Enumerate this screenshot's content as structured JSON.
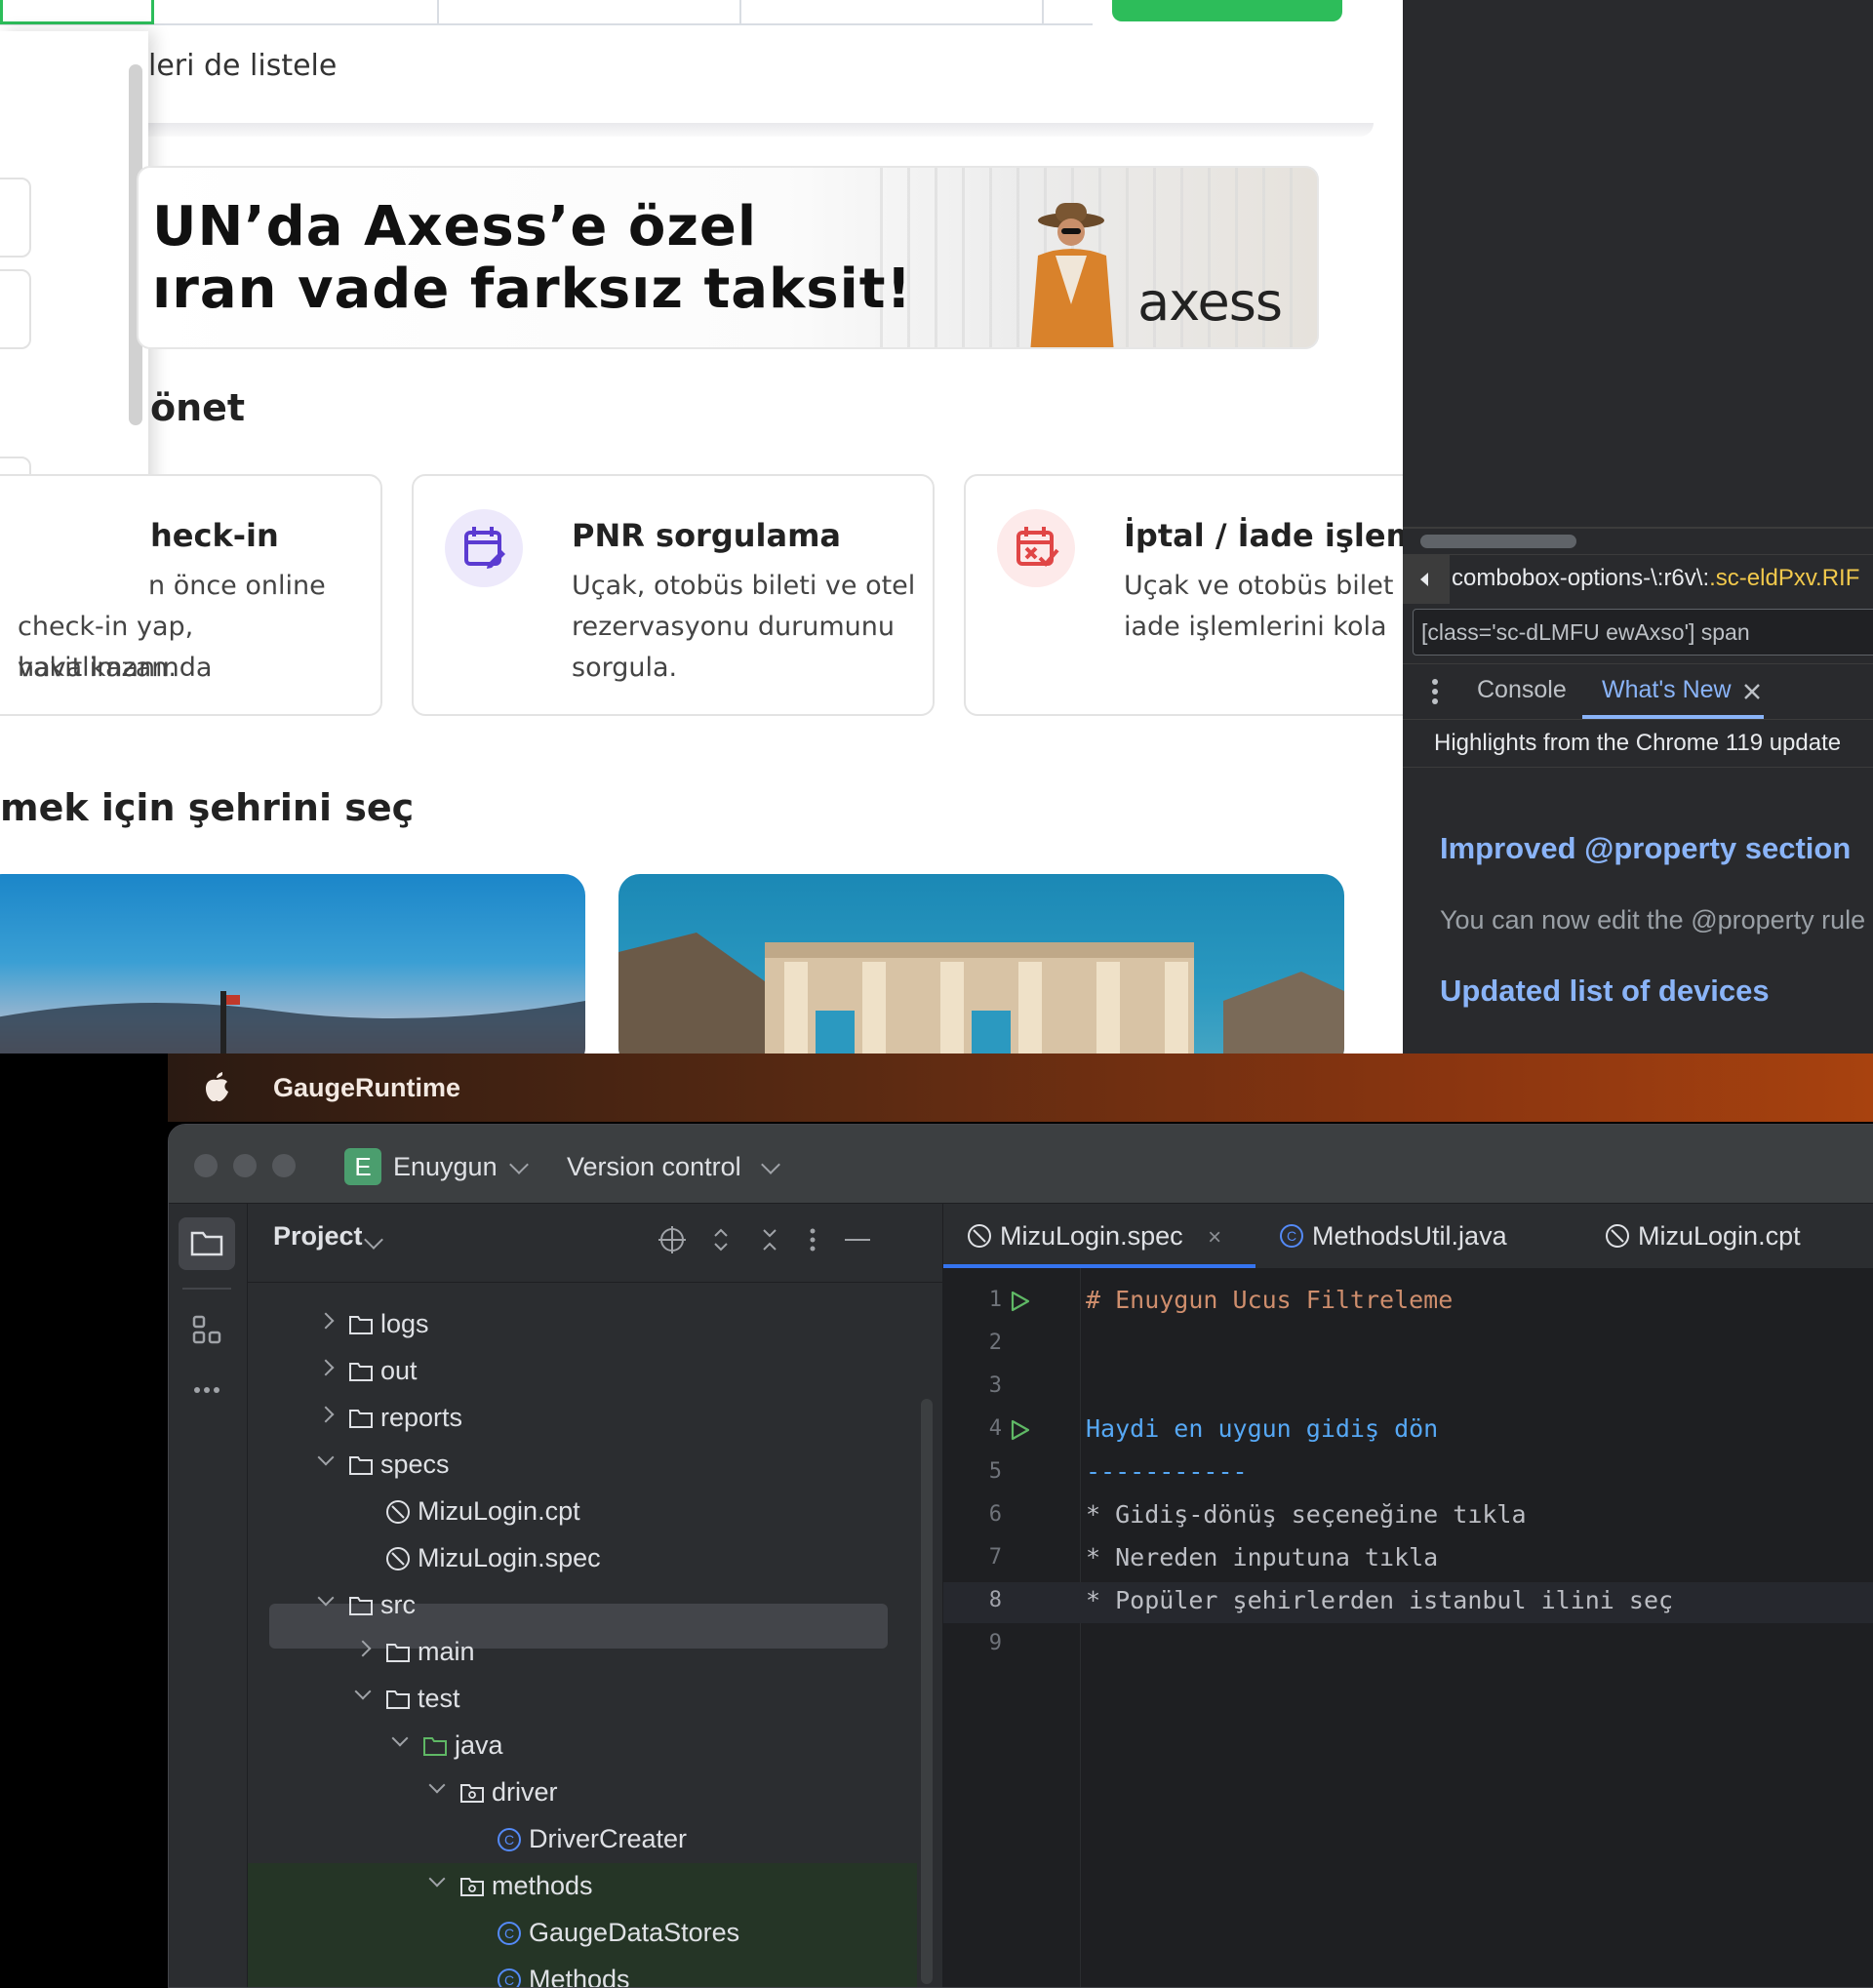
{
  "browser": {
    "list_also_text": "leri de listele",
    "banner": {
      "line1": "UN’da Axess’e özel",
      "line2": "ıran vade farksız taksit!",
      "brand": "axess"
    },
    "manage_title": "önet",
    "services": [
      {
        "title": "heck-in",
        "desc": [
          "n önce online",
          "check-in yap, havalimanında",
          "vakit kazan."
        ]
      },
      {
        "title": "PNR sorgulama",
        "desc": [
          "Uçak, otobüs bileti ve otel",
          "rezervasyonu durumunu",
          "sorgula."
        ]
      },
      {
        "title": "İptal / İade işlem",
        "desc": [
          "Uçak ve otobüs bilet",
          "iade işlemlerini kola"
        ]
      }
    ],
    "city_title": "mek için şehrini seç"
  },
  "devtools": {
    "crumb_text": "combobox-options-\\:r6v\\:",
    "crumb_class": ".sc-eldPxv.RIF",
    "selector_value": "[class='sc-dLMFU ewAxso'] span",
    "tabs": [
      "Console",
      "What's New"
    ],
    "highlights": "Highlights from the Chrome 119 update",
    "item1_title": "Improved @property section",
    "item1_desc": "You can now edit the @property rule",
    "item2_title": "Updated list of devices",
    "colors": {
      "link": "#8ab4f8"
    }
  },
  "menubar": {
    "app_name": "GaugeRuntime"
  },
  "ide": {
    "project_badge": "E",
    "project_name": "Enuygun",
    "vcs_label": "Version control",
    "panel_title": "Project",
    "tree": [
      {
        "label": "logs",
        "type": "folder",
        "depth": 1,
        "state": "collapsed"
      },
      {
        "label": "out",
        "type": "folder",
        "depth": 1,
        "state": "collapsed"
      },
      {
        "label": "reports",
        "type": "folder",
        "depth": 1,
        "state": "collapsed"
      },
      {
        "label": "specs",
        "type": "folder",
        "depth": 1,
        "state": "expanded"
      },
      {
        "label": "MizuLogin.cpt",
        "type": "gauge",
        "depth": 2
      },
      {
        "label": "MizuLogin.spec",
        "type": "gauge",
        "depth": 2,
        "selected": true
      },
      {
        "label": "src",
        "type": "folder",
        "depth": 1,
        "state": "expanded"
      },
      {
        "label": "main",
        "type": "folder",
        "depth": 2,
        "state": "collapsed"
      },
      {
        "label": "test",
        "type": "folder",
        "depth": 2,
        "state": "expanded"
      },
      {
        "label": "java",
        "type": "folder-green",
        "depth": 3,
        "state": "expanded"
      },
      {
        "label": "driver",
        "type": "package",
        "depth": 4,
        "state": "expanded"
      },
      {
        "label": "DriverCreater",
        "type": "class",
        "depth": 5
      },
      {
        "label": "methods",
        "type": "package",
        "depth": 4,
        "state": "expanded"
      },
      {
        "label": "GaugeDataStores",
        "type": "class",
        "depth": 5
      },
      {
        "label": "Methods",
        "type": "class",
        "depth": 5
      }
    ],
    "editor_tabs": [
      {
        "label": "MizuLogin.spec",
        "active": true,
        "icon": "gauge-icon"
      },
      {
        "label": "MethodsUtil.java",
        "active": false,
        "icon": "class-icon"
      },
      {
        "label": "MizuLogin.cpt",
        "active": false,
        "icon": "gauge-icon"
      }
    ],
    "code_lines": [
      {
        "n": "1",
        "text": "# Enuygun Ucus Filtreleme",
        "color": "#cf8e6d",
        "run": true
      },
      {
        "n": "2",
        "text": "",
        "color": "#bcbec4",
        "run": false
      },
      {
        "n": "3",
        "text": "",
        "color": "#bcbec4",
        "run": false
      },
      {
        "n": "4",
        "text": "Haydi en uygun gidiş dön",
        "color": "#56a8f5",
        "run": true
      },
      {
        "n": "5",
        "text": "-----------",
        "color": "#56a8f5",
        "run": false
      },
      {
        "n": "6",
        "text": "* Gidiş-dönüş seçeneğine tıkla",
        "color": "#bcbec4",
        "run": false
      },
      {
        "n": "7",
        "text": "* Nereden inputuna tıkla",
        "color": "#bcbec4",
        "run": false
      },
      {
        "n": "8",
        "text": "* Popüler şehirlerden istanbul ilini seç",
        "color": "#bcbec4",
        "run": false,
        "current": true
      },
      {
        "n": "9",
        "text": "",
        "color": "#bcbec4",
        "run": false
      }
    ]
  }
}
